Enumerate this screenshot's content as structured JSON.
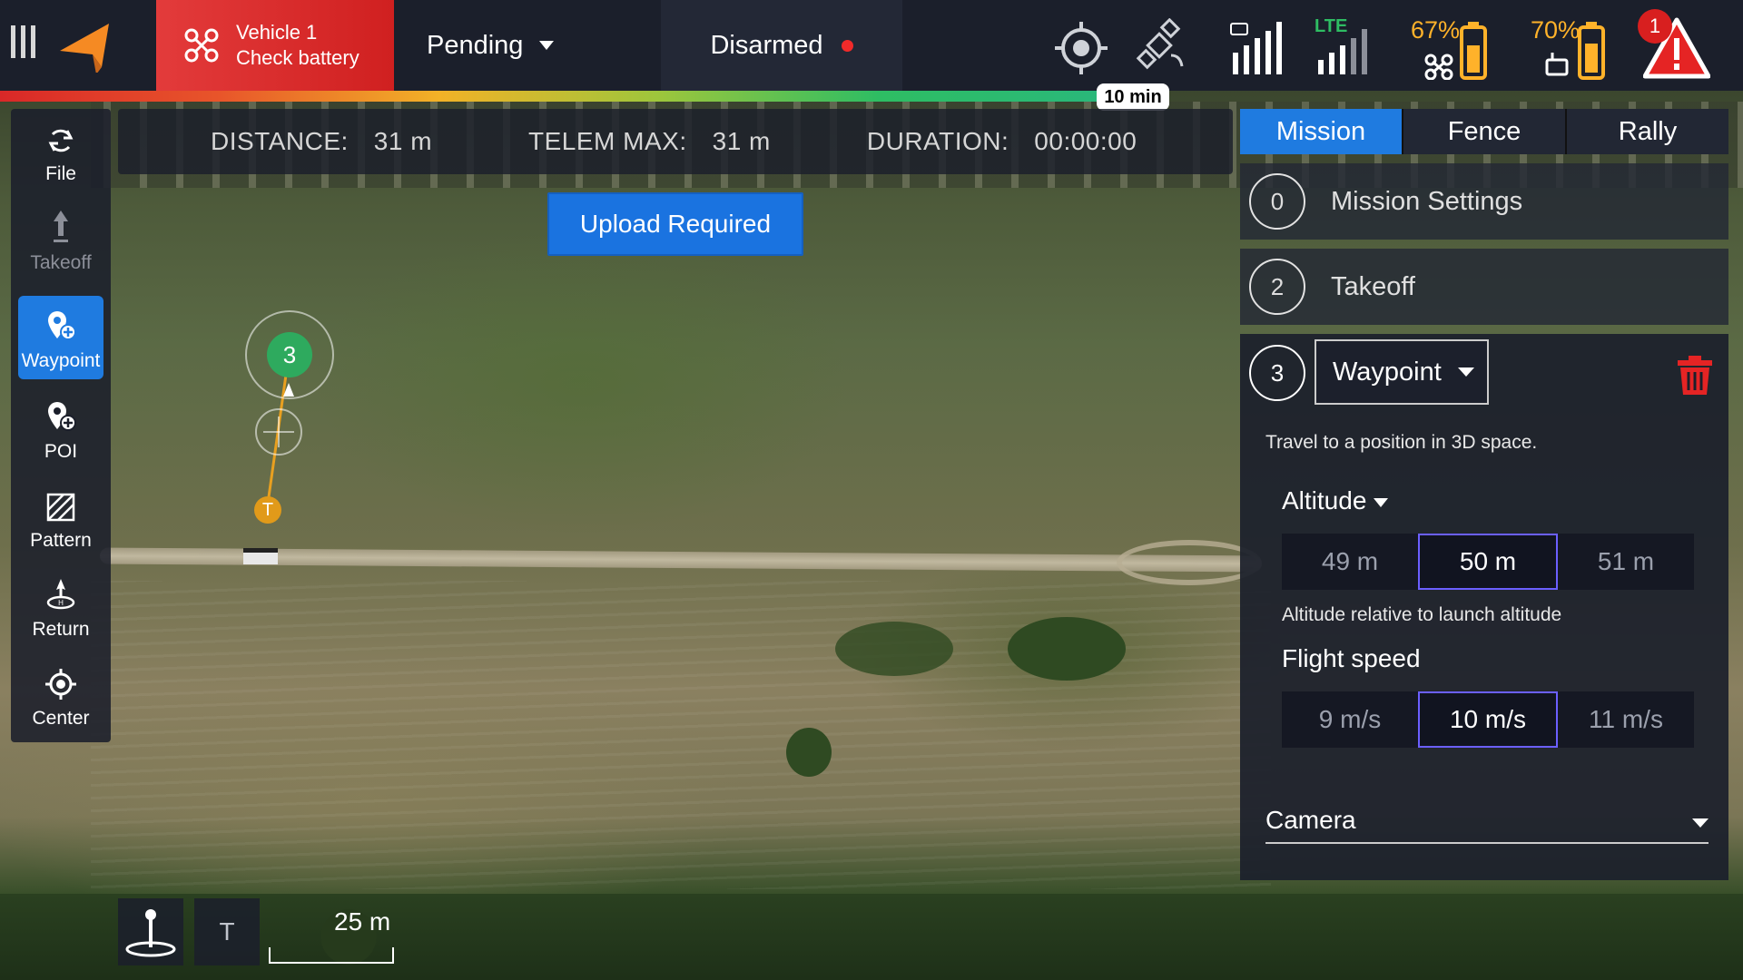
{
  "topbar": {
    "vehicle_name": "Vehicle 1",
    "vehicle_status": "Check battery",
    "flight_mode": "Pending",
    "arm_state": "Disarmed",
    "drone_battery_pct": "67%",
    "rc_battery_pct": "70%",
    "lte_label": "LTE",
    "alert_count": "1",
    "flight_time": "10 min"
  },
  "tools": {
    "file": "File",
    "takeoff": "Takeoff",
    "waypoint": "Waypoint",
    "poi": "POI",
    "pattern": "Pattern",
    "return": "Return",
    "center": "Center"
  },
  "telemetry": {
    "distance_label": "DISTANCE:",
    "distance_value": "31 m",
    "telem_max_label": "TELEM MAX:",
    "telem_max_value": "31 m",
    "duration_label": "DURATION:",
    "duration_value": "00:00:00"
  },
  "upload_button": "Upload Required",
  "map": {
    "waypoint_marker": "3",
    "takeoff_marker": "T",
    "scale_label": "25 m",
    "t_button": "T"
  },
  "panel": {
    "tabs": [
      "Mission",
      "Fence",
      "Rally"
    ],
    "items": [
      {
        "num": "0",
        "title": "Mission Settings"
      },
      {
        "num": "2",
        "title": "Takeoff"
      }
    ],
    "editor": {
      "num": "3",
      "type": "Waypoint",
      "description": "Travel to a position in 3D space.",
      "altitude_label": "Altitude",
      "altitude_options": [
        "49 m",
        "50 m",
        "51 m"
      ],
      "altitude_selected": "50 m",
      "altitude_note": "Altitude relative to launch altitude",
      "speed_label": "Flight speed",
      "speed_options": [
        "9 m/s",
        "10 m/s",
        "11 m/s"
      ],
      "speed_selected": "10 m/s",
      "camera_label": "Camera"
    }
  },
  "colors": {
    "accent": "#1f7be0",
    "danger": "#d81f1f",
    "battery": "#ffb22a",
    "waypoint": "#2eaa5e",
    "takeoff": "#e19a1a"
  }
}
